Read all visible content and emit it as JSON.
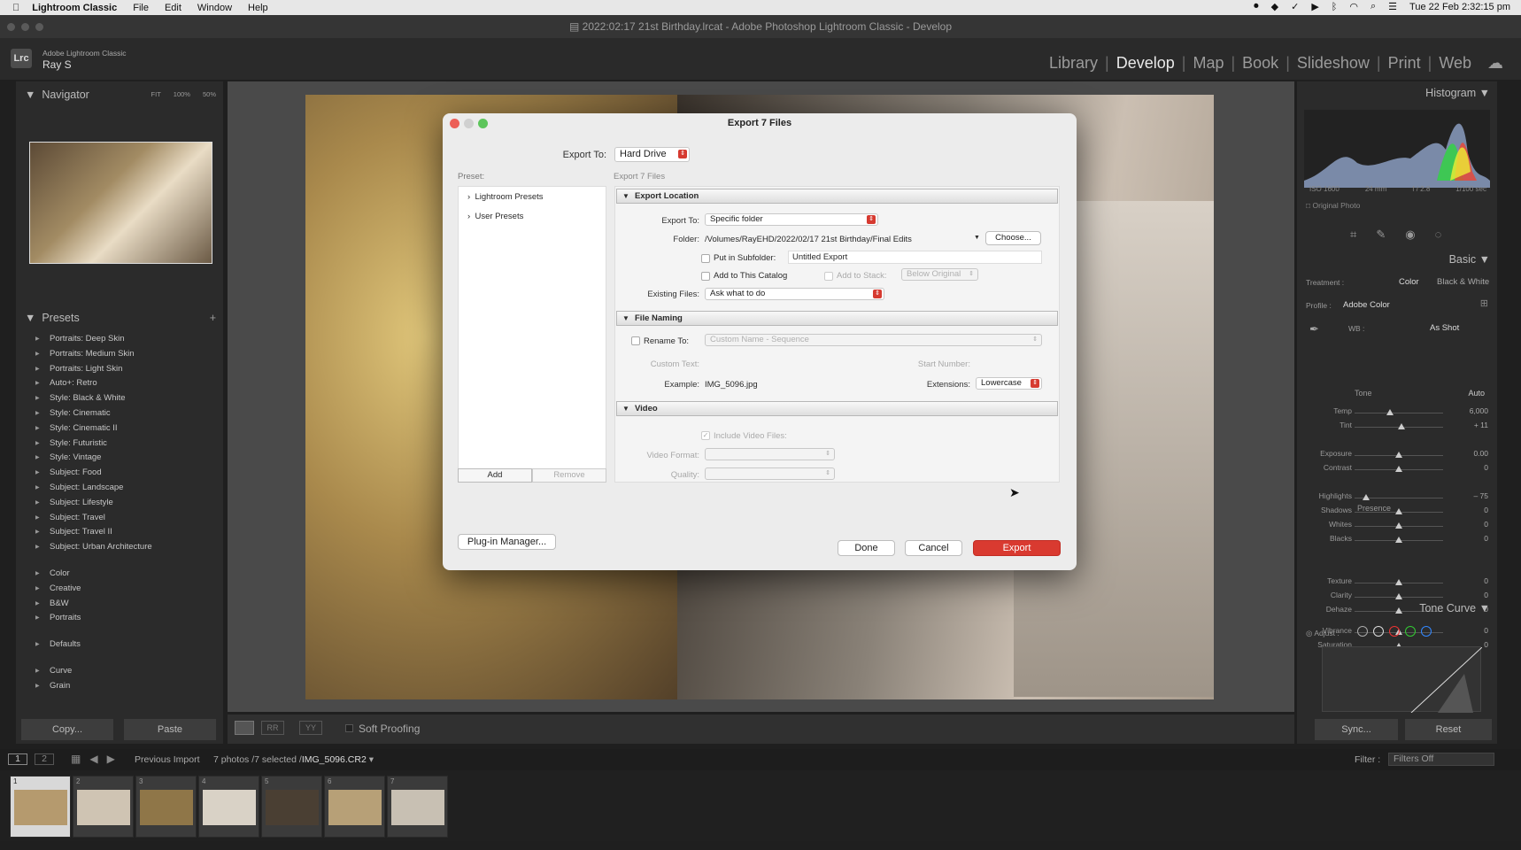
{
  "menubar": {
    "app": "Lightroom Classic",
    "items": [
      "File",
      "Edit",
      "Window",
      "Help"
    ],
    "datetime": "Tue 22 Feb  2:32:15 pm"
  },
  "window": {
    "title": "2022:02:17 21st Birthday.lrcat - Adobe Photoshop Lightroom Classic - Develop"
  },
  "identity": {
    "badge": "Lrc",
    "product": "Adobe Lightroom Classic",
    "user": "Ray S"
  },
  "modules": [
    "Library",
    "Develop",
    "Map",
    "Book",
    "Slideshow",
    "Print",
    "Web"
  ],
  "active_module": "Develop",
  "navigator": {
    "title": "Navigator",
    "zoom": [
      "FIT",
      "100%",
      "50%"
    ]
  },
  "presets": {
    "title": "Presets",
    "items": [
      "Portraits: Deep Skin",
      "Portraits: Medium Skin",
      "Portraits: Light Skin",
      "Auto+: Retro",
      "Style: Black & White",
      "Style: Cinematic",
      "Style: Cinematic II",
      "Style: Futuristic",
      "Style: Vintage",
      "Subject: Food",
      "Subject: Landscape",
      "Subject: Lifestyle",
      "Subject: Travel",
      "Subject: Travel II",
      "Subject: Urban Architecture"
    ],
    "groups": [
      "Color",
      "Creative",
      "B&W",
      "Portraits"
    ],
    "groups2": [
      "Defaults"
    ],
    "groups3": [
      "Curve",
      "Grain"
    ]
  },
  "leftbuttons": {
    "copy": "Copy...",
    "paste": "Paste"
  },
  "toolbar": {
    "soft_proofing": "Soft Proofing"
  },
  "histogram": {
    "title": "Histogram",
    "iso": "ISO 1600",
    "focal": "24 mm",
    "aperture": "f / 2.8",
    "shutter": "1/100 sec",
    "original_photo": "Original Photo"
  },
  "basic": {
    "title": "Basic",
    "treatment_label": "Treatment :",
    "treatment_color": "Color",
    "treatment_bw": "Black & White",
    "profile_label": "Profile :",
    "profile": "Adobe Color",
    "wb_label": "WB :",
    "wb": "As Shot",
    "tone_label": "Tone",
    "auto": "Auto",
    "presence_label": "Presence",
    "sliders": [
      {
        "name": "Temp",
        "value": "6,000",
        "pos": 0.4
      },
      {
        "name": "Tint",
        "value": "+ 11",
        "pos": 0.53
      },
      {
        "name": "Exposure",
        "value": "0.00",
        "pos": 0.5
      },
      {
        "name": "Contrast",
        "value": "0",
        "pos": 0.5
      },
      {
        "name": "Highlights",
        "value": "– 75",
        "pos": 0.13
      },
      {
        "name": "Shadows",
        "value": "0",
        "pos": 0.5
      },
      {
        "name": "Whites",
        "value": "0",
        "pos": 0.5
      },
      {
        "name": "Blacks",
        "value": "0",
        "pos": 0.5
      },
      {
        "name": "Texture",
        "value": "0",
        "pos": 0.5
      },
      {
        "name": "Clarity",
        "value": "0",
        "pos": 0.5
      },
      {
        "name": "Dehaze",
        "value": "0",
        "pos": 0.5
      },
      {
        "name": "Vibrance",
        "value": "0",
        "pos": 0.5
      },
      {
        "name": "Saturation",
        "value": "0",
        "pos": 0.5
      }
    ]
  },
  "tonecurve": {
    "title": "Tone Curve",
    "adjust": "Adjust :"
  },
  "rightbuttons": {
    "sync": "Sync...",
    "reset": "Reset"
  },
  "filmstrip": {
    "source": "Previous Import",
    "count": "7 photos /7 selected /",
    "file": "IMG_5096.CR2",
    "filter_label": "Filter :",
    "filter": "Filters Off",
    "thumbs": [
      "1",
      "2",
      "3",
      "4",
      "5",
      "6",
      "7"
    ],
    "pages": [
      "1",
      "2"
    ]
  },
  "dialog": {
    "title": "Export 7 Files",
    "export_to_label": "Export To:",
    "export_to": "Hard Drive",
    "preset_label": "Preset:",
    "section_caption": "Export 7 Files",
    "preset_items": [
      "Lightroom Presets",
      "User Presets"
    ],
    "add": "Add",
    "remove": "Remove",
    "location": {
      "title": "Export Location",
      "export_to_label": "Export To:",
      "export_to": "Specific folder",
      "folder_label": "Folder:",
      "folder": "/Volumes/RayEHD/2022/02/17 21st Birthday/Final Edits",
      "choose": "Choose...",
      "subfolder_label": "Put in Subfolder:",
      "subfolder": "Untitled Export",
      "add_catalog": "Add to This Catalog",
      "add_stack": "Add to Stack:",
      "stack_option": "Below Original",
      "existing_label": "Existing Files:",
      "existing": "Ask what to do"
    },
    "naming": {
      "title": "File Naming",
      "rename_label": "Rename To:",
      "rename": "Custom Name - Sequence",
      "custom_text": "Custom Text:",
      "start_number": "Start Number:",
      "example_label": "Example:",
      "example": "IMG_5096.jpg",
      "extensions_label": "Extensions:",
      "extensions": "Lowercase"
    },
    "video": {
      "title": "Video",
      "include": "Include Video Files:",
      "format_label": "Video Format:",
      "quality_label": "Quality:"
    },
    "plugin": "Plug-in Manager...",
    "done": "Done",
    "cancel": "Cancel",
    "export": "Export"
  }
}
